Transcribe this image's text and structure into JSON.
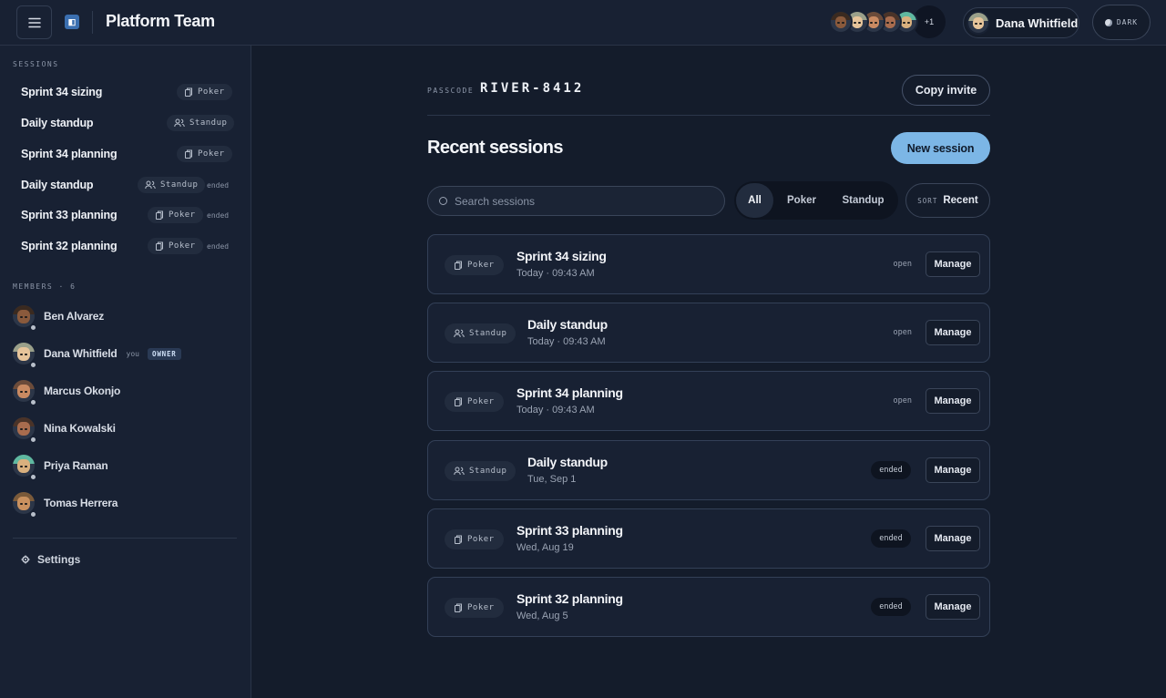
{
  "header": {
    "team_title": "Platform Team",
    "more_count": "+1",
    "user_name": "Dana Whitfield",
    "theme_label": "DARK",
    "avatars": [
      {
        "name": "Ben Alvarez",
        "skin": "#8a5a3c",
        "hair": "#3a2a20"
      },
      {
        "name": "Dana Whitfield",
        "skin": "#e6c49a",
        "hair": "#9aa08a"
      },
      {
        "name": "Marcus Okonjo",
        "skin": "#c98a62",
        "hair": "#6b4b3a"
      },
      {
        "name": "Nina Kowalski",
        "skin": "#a86c4e",
        "hair": "#4a3328"
      },
      {
        "name": "Priya Raman",
        "skin": "#d9b07e",
        "hair": "#5fb8a0"
      }
    ]
  },
  "sidebar": {
    "sessions_label": "SESSIONS",
    "sessions": [
      {
        "title": "Sprint 34 sizing",
        "type": "Poker",
        "status": ""
      },
      {
        "title": "Daily standup",
        "type": "Standup",
        "status": ""
      },
      {
        "title": "Sprint 34 planning",
        "type": "Poker",
        "status": ""
      },
      {
        "title": "Daily standup",
        "type": "Standup",
        "status": "ended"
      },
      {
        "title": "Sprint 33 planning",
        "type": "Poker",
        "status": "ended"
      },
      {
        "title": "Sprint 32 planning",
        "type": "Poker",
        "status": "ended"
      }
    ],
    "members_label": "MEMBERS · 6",
    "members": [
      {
        "name": "Ben Alvarez",
        "skin": "#8a5a3c",
        "hair": "#3a2a20"
      },
      {
        "name": "Dana Whitfield",
        "skin": "#e6c49a",
        "hair": "#9aa08a",
        "you": "you",
        "role": "OWNER"
      },
      {
        "name": "Marcus Okonjo",
        "skin": "#c98a62",
        "hair": "#6b4b3a"
      },
      {
        "name": "Nina Kowalski",
        "skin": "#a86c4e",
        "hair": "#4a3328"
      },
      {
        "name": "Priya Raman",
        "skin": "#d9b07e",
        "hair": "#5fb8a0"
      },
      {
        "name": "Tomas Herrera",
        "skin": "#c9915f",
        "hair": "#7a5a3a"
      }
    ],
    "settings_label": "Settings"
  },
  "main": {
    "passcode_label": "PASSCODE",
    "passcode": "RIVER-8412",
    "copy_invite": "Copy invite",
    "recent_title": "Recent sessions",
    "new_session": "New session",
    "search_placeholder": "Search sessions",
    "filters": [
      "All",
      "Poker",
      "Standup"
    ],
    "active_filter": "All",
    "sort_label": "SORT",
    "sort_value": "Recent",
    "manage_label": "Manage",
    "sessions": [
      {
        "title": "Sprint 34 sizing",
        "type": "Poker",
        "date": "Today · 09:43 AM",
        "status": "open"
      },
      {
        "title": "Daily standup",
        "type": "Standup",
        "date": "Today · 09:43 AM",
        "status": "open"
      },
      {
        "title": "Sprint 34 planning",
        "type": "Poker",
        "date": "Today · 09:43 AM",
        "status": "open"
      },
      {
        "title": "Daily standup",
        "type": "Standup",
        "date": "Tue, Sep 1",
        "status": "ended"
      },
      {
        "title": "Sprint 33 planning",
        "type": "Poker",
        "date": "Wed, Aug 19",
        "status": "ended"
      },
      {
        "title": "Sprint 32 planning",
        "type": "Poker",
        "date": "Wed, Aug 5",
        "status": "ended"
      }
    ]
  }
}
